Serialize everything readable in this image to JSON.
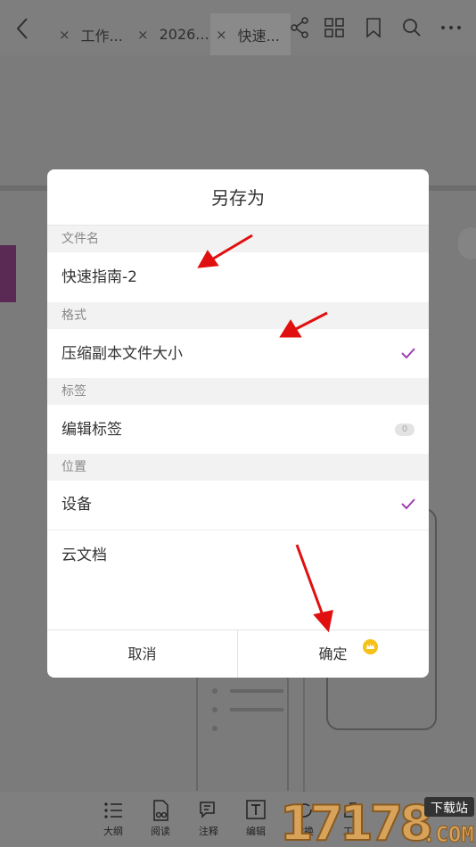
{
  "topbar": {
    "tabs": [
      {
        "label": "工作..."
      },
      {
        "label": "2026..."
      },
      {
        "label": "快速..."
      }
    ],
    "close_glyph": "×",
    "icons": [
      "back-icon",
      "share-icon",
      "grid-icon",
      "bookmark-icon",
      "search-icon",
      "more-icon"
    ]
  },
  "dialog": {
    "title": "另存为",
    "sections": {
      "filename": {
        "header": "文件名",
        "value": "快速指南-2"
      },
      "format": {
        "header": "格式",
        "value": "压缩副本文件大小",
        "checked": true
      },
      "tags": {
        "header": "标签",
        "value": "编辑标签",
        "count": "0"
      },
      "location": {
        "header": "位置",
        "options": [
          {
            "label": "设备",
            "checked": true
          },
          {
            "label": "云文档",
            "checked": false
          }
        ]
      }
    },
    "cancel_label": "取消",
    "confirm_label": "确定"
  },
  "bottombar": {
    "items": [
      {
        "label": "大纲",
        "icon": "outline-icon"
      },
      {
        "label": "阅读",
        "icon": "read-icon"
      },
      {
        "label": "注释",
        "icon": "comment-icon"
      },
      {
        "label": "编辑",
        "icon": "edit-text-icon"
      },
      {
        "label": "转换",
        "icon": "convert-icon"
      },
      {
        "label": "工具",
        "icon": "tools-icon"
      }
    ]
  },
  "watermark": {
    "left": "17178",
    "tag": "下载站",
    "domain": ".COM"
  },
  "colors": {
    "accent": "#9c3fb0",
    "annotation_arrow": "#e01010",
    "crown": "#f6c21a"
  }
}
